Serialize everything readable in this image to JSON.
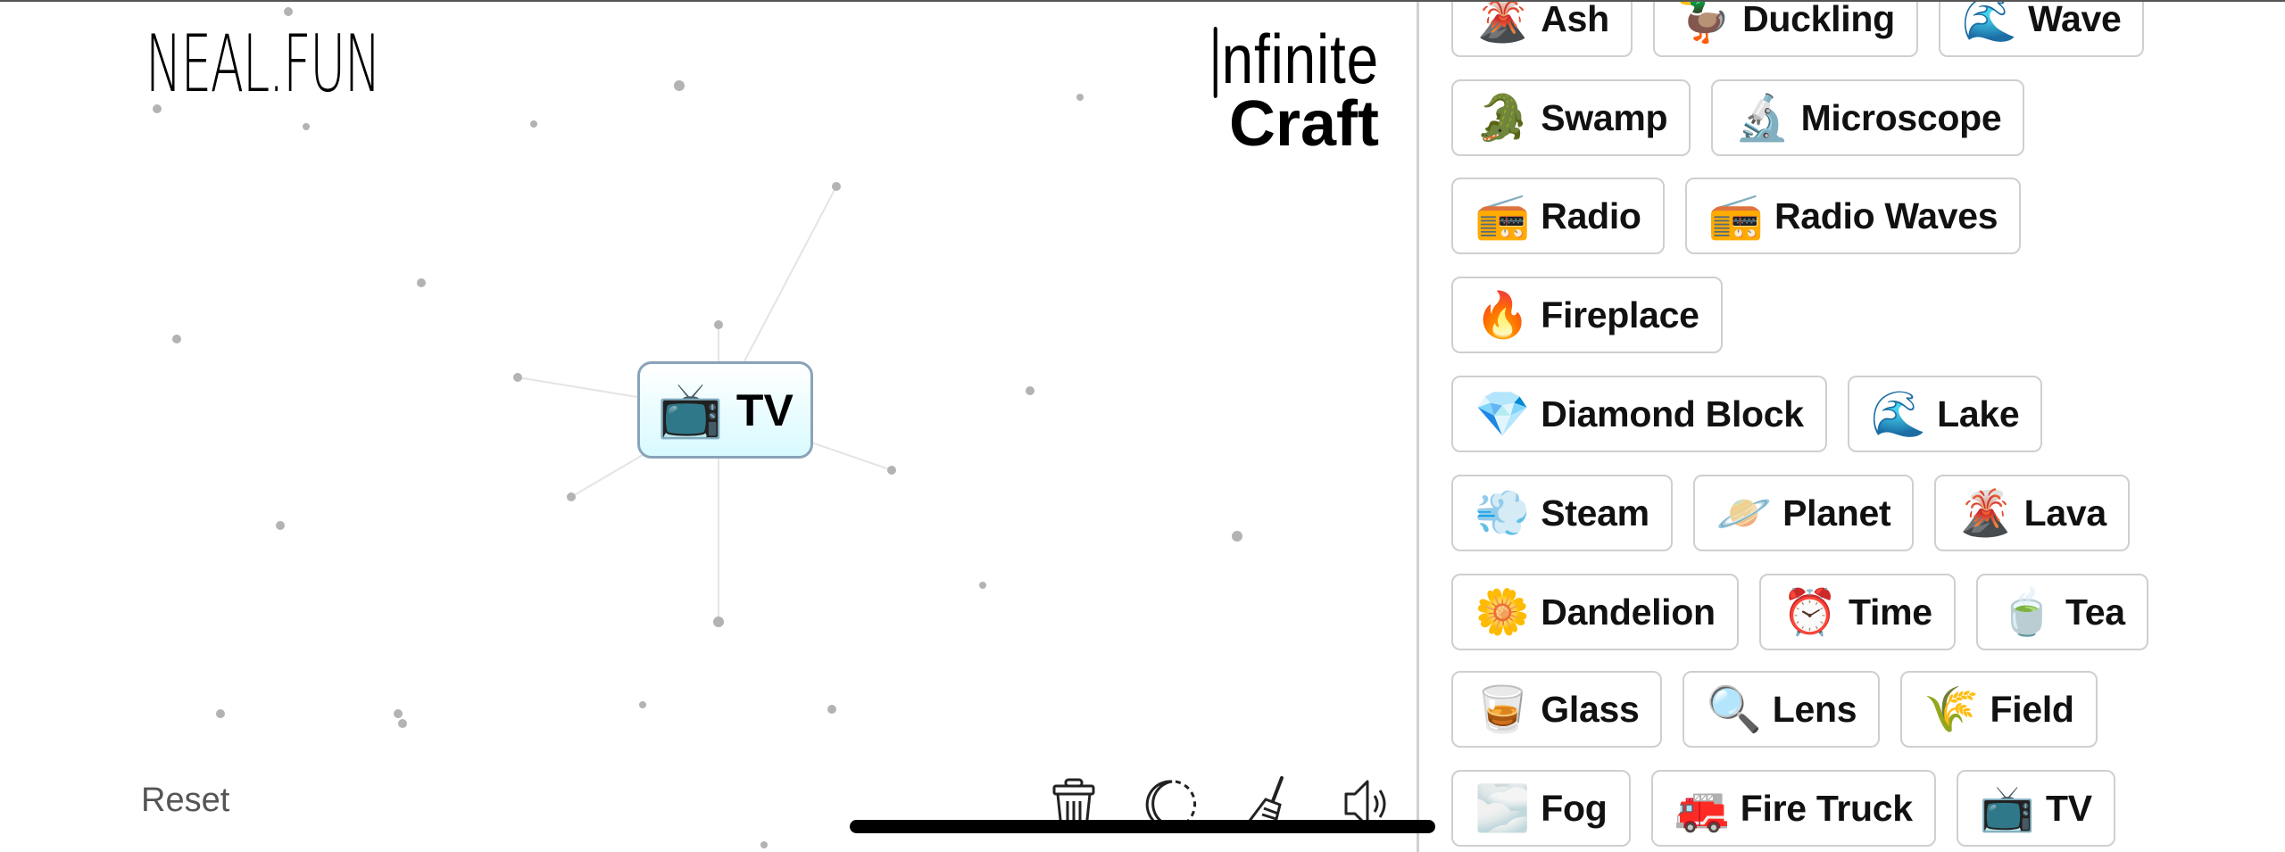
{
  "header": {
    "site_logo": "NEAL.FUN",
    "app_title_line1": "nfinite",
    "app_title_line2": "Craft"
  },
  "canvas": {
    "placed_items": [
      {
        "emoji": "📺",
        "label": "TV",
        "icon": "tv-icon"
      }
    ]
  },
  "footer": {
    "reset_label": "Reset",
    "tools": [
      {
        "name": "trash-icon",
        "label": "Clear"
      },
      {
        "name": "moon-icon",
        "label": "Dark mode"
      },
      {
        "name": "broom-icon",
        "label": "Clean up"
      },
      {
        "name": "speaker-icon",
        "label": "Sound"
      }
    ]
  },
  "sidebar": {
    "rows": [
      [
        {
          "emoji": "🌋",
          "label": "Ash"
        },
        {
          "emoji": "🦆",
          "label": "Duckling"
        },
        {
          "emoji": "🌊",
          "label": "Wave"
        }
      ],
      [
        {
          "emoji": "🐊",
          "label": "Swamp"
        },
        {
          "emoji": "🔬",
          "label": "Microscope"
        }
      ],
      [
        {
          "emoji": "📻",
          "label": "Radio"
        },
        {
          "emoji": "📻",
          "label": "Radio Waves"
        }
      ],
      [
        {
          "emoji": "🔥",
          "label": "Fireplace"
        }
      ],
      [
        {
          "emoji": "💎",
          "label": "Diamond Block"
        },
        {
          "emoji": "🌊",
          "label": "Lake"
        }
      ],
      [
        {
          "emoji": "💨",
          "label": "Steam"
        },
        {
          "emoji": "🪐",
          "label": "Planet"
        },
        {
          "emoji": "🌋",
          "label": "Lava"
        }
      ],
      [
        {
          "emoji": "🌼",
          "label": "Dandelion"
        },
        {
          "emoji": "⏰",
          "label": "Time"
        },
        {
          "emoji": "🍵",
          "label": "Tea"
        }
      ],
      [
        {
          "emoji": "🥃",
          "label": "Glass"
        },
        {
          "emoji": "🔍",
          "label": "Lens"
        },
        {
          "emoji": "🌾",
          "label": "Field"
        }
      ],
      [
        {
          "emoji": "🌫️",
          "label": "Fog"
        },
        {
          "emoji": "🚒",
          "label": "Fire Truck"
        },
        {
          "emoji": "📺",
          "label": "TV"
        }
      ]
    ]
  },
  "colors": {
    "item_border": "#cfcfcf",
    "active_item_border": "#8aa3b8",
    "active_item_bg": "#d8faff",
    "reset_text": "#555555",
    "dot": "#b0b0b0"
  }
}
